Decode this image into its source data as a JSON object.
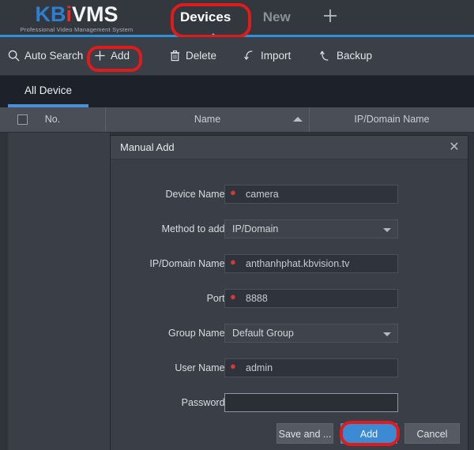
{
  "app": {
    "logo": {
      "part1": "KB",
      "part2": "i",
      "part3": "VMS",
      "tagline": "Professional Video Management System"
    },
    "brand_blue": "#2f7fd0",
    "brand_red": "#e03030",
    "accent": "#4a90d9",
    "annotation_color": "#e01b1b"
  },
  "nav": {
    "tabs": [
      {
        "label": "Devices",
        "active": true
      },
      {
        "label": "New",
        "active": false
      }
    ],
    "add_tab_icon": "plus-icon",
    "add_tab_label": "+"
  },
  "toolbar": {
    "buttons": [
      {
        "label": "Auto Search",
        "icon": "search-icon"
      },
      {
        "label": "Add",
        "icon": "plus-icon"
      },
      {
        "label": "Delete",
        "icon": "trash-icon"
      },
      {
        "label": "Import",
        "icon": "import-arrow-icon"
      },
      {
        "label": "Backup",
        "icon": "backup-arrow-icon"
      }
    ]
  },
  "device_tabs": [
    {
      "label": "All Device",
      "active": true
    }
  ],
  "table": {
    "columns": [
      {
        "label": "No."
      },
      {
        "label": "Name",
        "sort": "ascending"
      },
      {
        "label": "IP/Domain Name"
      }
    ],
    "select_all_checked": false,
    "rows": []
  },
  "dialog": {
    "title": "Manual Add",
    "close_icon": "close-icon",
    "fields": [
      {
        "label": "Device Name:",
        "value": "camera",
        "type": "text",
        "required": true,
        "placeholder": ""
      },
      {
        "label": "Method to add:",
        "value": "IP/Domain",
        "type": "select",
        "required": false
      },
      {
        "label": "IP/Domain Name:",
        "value": "anthanhphat.kbvision.tv",
        "type": "text",
        "required": true,
        "placeholder": ""
      },
      {
        "label": "Port:",
        "value": "8888",
        "type": "text",
        "required": true,
        "placeholder": ""
      },
      {
        "label": "Group Name:",
        "value": "Default Group",
        "type": "select",
        "required": false
      },
      {
        "label": "User Name:",
        "value": "admin",
        "type": "text",
        "required": true,
        "placeholder": ""
      },
      {
        "label": "Password:",
        "value": "",
        "type": "password",
        "required": false,
        "placeholder": ""
      }
    ],
    "buttons": [
      {
        "label": "Save and ...",
        "primary": false
      },
      {
        "label": "Add",
        "primary": true
      },
      {
        "label": "Cancel",
        "primary": false
      }
    ]
  }
}
